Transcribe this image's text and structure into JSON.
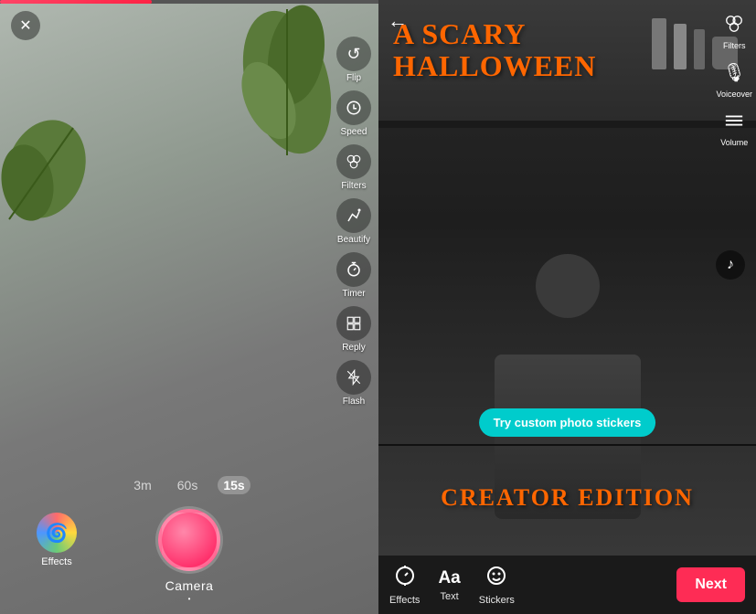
{
  "camera": {
    "progress_percent": 40,
    "close_label": "✕",
    "toolbar": [
      {
        "id": "flip",
        "icon": "↺",
        "label": "Flip"
      },
      {
        "id": "speed",
        "icon": "⚡",
        "label": "Speed"
      },
      {
        "id": "filters",
        "icon": "✦",
        "label": "Filters"
      },
      {
        "id": "beautify",
        "icon": "✏",
        "label": "Beautify"
      },
      {
        "id": "timer",
        "icon": "⏱",
        "label": "Timer"
      },
      {
        "id": "reply",
        "icon": "⊞",
        "label": "Reply"
      },
      {
        "id": "flash",
        "icon": "⚡",
        "label": "Flash"
      }
    ],
    "durations": [
      {
        "label": "3m",
        "active": false
      },
      {
        "label": "60s",
        "active": false
      },
      {
        "label": "15s",
        "active": true
      }
    ],
    "effects_label": "Effects",
    "label": "Camera",
    "dot": "•"
  },
  "editor": {
    "back_icon": "←",
    "title_line1": "A SCARY",
    "title_line2": "HALLOWEEN",
    "creator_edition": "CREATOR EDITION",
    "sidebar_tools": [
      {
        "id": "filters",
        "icon": "✦",
        "label": "Filters"
      },
      {
        "id": "voiceover",
        "icon": "🎙",
        "label": "Voiceover"
      },
      {
        "id": "volume",
        "icon": "≡",
        "label": "Volume"
      }
    ],
    "sticker_banner": "Try custom photo stickers",
    "bottom_tools": [
      {
        "id": "effects",
        "icon": "⏱",
        "label": "Effects"
      },
      {
        "id": "text",
        "icon": "Aa",
        "label": "Text"
      },
      {
        "id": "stickers",
        "icon": "☺",
        "label": "Stickers"
      }
    ],
    "next_button": "Next"
  }
}
